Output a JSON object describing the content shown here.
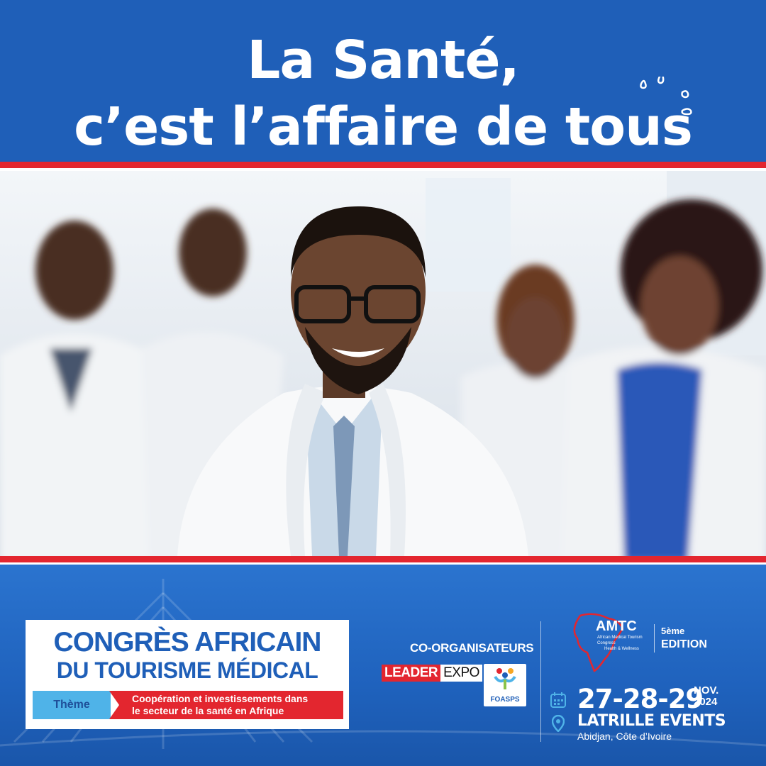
{
  "headline": {
    "line1": "La Santé,",
    "line2": "c’est l’affaire de tous"
  },
  "event": {
    "title_line1": "CONGRÈS AFRICAIN",
    "title_line2": "DU TOURISME MÉDICAL",
    "theme_label": "Thème",
    "theme_text_line1": "Coopération et investissements dans",
    "theme_text_line2": "le secteur de la santé en Afrique"
  },
  "coorganisers": {
    "label": "CO-ORGANISATEURS",
    "leader_part1": "LEADER",
    "leader_part2": "EXPO",
    "foasps": "FOASPS"
  },
  "amtc": {
    "title": "AMTC",
    "subtitle1": "African Medical Tourism",
    "subtitle2": "Congress",
    "subtitle3": "Health & Wellness",
    "edition_number": "5ème",
    "edition_label": "EDITION"
  },
  "schedule": {
    "dates": "27-28-29",
    "month": "NOV.",
    "year": "2024",
    "venue": "LATRILLE EVENTS",
    "city": "Abidjan, Côte d’Ivoire"
  },
  "colors": {
    "brand_blue": "#1f5fb8",
    "accent_red": "#e3262f",
    "theme_cyan": "#4fb3e8"
  }
}
